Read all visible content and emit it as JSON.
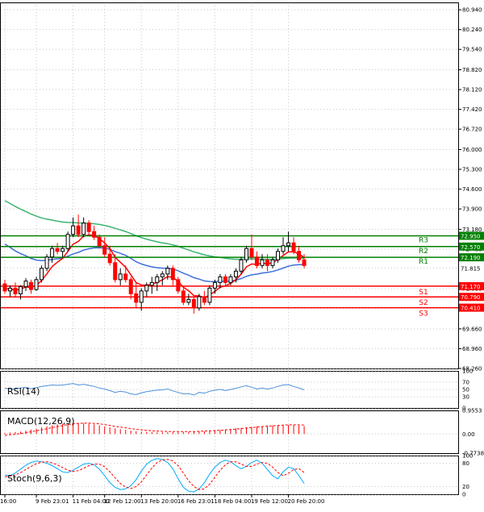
{
  "colors": {
    "background": "#ffffff",
    "grid": "#c8c8c8",
    "frame": "#000000",
    "bull_candle": "#000000",
    "bear_candle": "#ff0000",
    "ema_fast": "#ff0000",
    "ema_medium": "#3f6fd8",
    "ema_slow": "#3cb371",
    "resistance": "#008000",
    "support": "#ff0000",
    "current_price": "#000000",
    "rsi_line": "#4a90d9",
    "macd_signal": "#ff0000",
    "macd_hist": "#ff0000",
    "stoch_main": "#00aaff",
    "stoch_signal": "#ff0000"
  },
  "chart_data": {
    "type": "candlestick",
    "price_panel": {
      "ylim": [
        68.26,
        81.2
      ],
      "y_ticks": [
        "80.940",
        "80.240",
        "79.540",
        "78.820",
        "78.120",
        "77.420",
        "76.720",
        "76.000",
        "75.300",
        "74.600",
        "73.900",
        "73.180",
        "72.480",
        "71.815",
        "71.080",
        "70.380",
        "69.660",
        "68.960",
        "68.260"
      ],
      "y_tick_values": [
        80.94,
        80.24,
        79.54,
        78.82,
        78.12,
        77.42,
        76.72,
        76.0,
        75.3,
        74.6,
        73.9,
        73.18,
        72.48,
        71.815,
        71.08,
        70.38,
        69.66,
        68.96,
        68.26
      ],
      "current_price": {
        "value": 71.815,
        "label": "71.815"
      },
      "levels": [
        {
          "name": "R3",
          "value": 72.95,
          "label": "72.950",
          "kind": "resistance"
        },
        {
          "name": "R2",
          "value": 72.57,
          "label": "72.570",
          "kind": "resistance"
        },
        {
          "name": "R1",
          "value": 72.19,
          "label": "72.190",
          "kind": "resistance"
        },
        {
          "name": "S1",
          "value": 71.17,
          "label": "71.170",
          "kind": "support"
        },
        {
          "name": "S2",
          "value": 70.79,
          "label": "70.790",
          "kind": "support"
        },
        {
          "name": "S3",
          "value": 70.41,
          "label": "70.410",
          "kind": "support"
        }
      ],
      "candles": [
        [
          71.25,
          71.4,
          70.9,
          71.0
        ],
        [
          71.0,
          71.2,
          70.8,
          71.1
        ],
        [
          71.1,
          71.3,
          70.8,
          70.9
        ],
        [
          70.9,
          71.2,
          70.7,
          71.15
        ],
        [
          71.15,
          71.45,
          71.0,
          71.35
        ],
        [
          71.3,
          71.4,
          70.9,
          71.05
        ],
        [
          71.05,
          71.5,
          71.0,
          71.4
        ],
        [
          71.4,
          71.9,
          71.3,
          71.8
        ],
        [
          71.8,
          72.3,
          71.7,
          72.2
        ],
        [
          72.2,
          72.6,
          72.0,
          72.5
        ],
        [
          72.5,
          72.7,
          72.3,
          72.4
        ],
        [
          72.4,
          72.6,
          72.2,
          72.5
        ],
        [
          72.5,
          73.1,
          72.4,
          73.0
        ],
        [
          73.0,
          73.6,
          72.9,
          73.3
        ],
        [
          73.3,
          73.7,
          72.9,
          73.0
        ],
        [
          73.0,
          73.6,
          72.9,
          73.4
        ],
        [
          73.4,
          73.5,
          73.0,
          73.1
        ],
        [
          73.1,
          73.3,
          72.8,
          72.9
        ],
        [
          72.9,
          73.0,
          72.5,
          72.6
        ],
        [
          72.6,
          72.9,
          72.2,
          72.3
        ],
        [
          72.3,
          72.6,
          71.9,
          72.0
        ],
        [
          72.0,
          72.3,
          71.3,
          71.4
        ],
        [
          71.4,
          71.8,
          71.2,
          71.6
        ],
        [
          71.6,
          71.9,
          71.3,
          71.4
        ],
        [
          71.4,
          71.5,
          70.7,
          70.9
        ],
        [
          70.9,
          71.3,
          70.4,
          70.6
        ],
        [
          70.6,
          71.1,
          70.3,
          71.0
        ],
        [
          71.0,
          71.3,
          70.8,
          71.2
        ],
        [
          71.2,
          71.5,
          70.9,
          71.3
        ],
        [
          71.3,
          71.6,
          71.0,
          71.5
        ],
        [
          71.5,
          71.7,
          71.2,
          71.6
        ],
        [
          71.6,
          71.9,
          71.4,
          71.8
        ],
        [
          71.8,
          71.9,
          71.2,
          71.4
        ],
        [
          71.4,
          71.5,
          70.9,
          71.0
        ],
        [
          71.0,
          71.1,
          70.5,
          70.6
        ],
        [
          70.6,
          70.9,
          70.5,
          70.7
        ],
        [
          70.7,
          70.8,
          70.2,
          70.4
        ],
        [
          70.4,
          70.9,
          70.3,
          70.8
        ],
        [
          70.8,
          71.0,
          70.5,
          70.6
        ],
        [
          70.6,
          71.2,
          70.5,
          71.1
        ],
        [
          71.1,
          71.4,
          70.9,
          71.3
        ],
        [
          71.3,
          71.6,
          71.1,
          71.5
        ],
        [
          71.5,
          71.6,
          71.2,
          71.3
        ],
        [
          71.3,
          71.6,
          71.2,
          71.5
        ],
        [
          71.5,
          71.8,
          71.3,
          71.7
        ],
        [
          71.7,
          72.2,
          71.6,
          72.1
        ],
        [
          72.1,
          72.6,
          72.0,
          72.5
        ],
        [
          72.5,
          73.0,
          72.1,
          72.2
        ],
        [
          72.2,
          72.4,
          71.8,
          71.9
        ],
        [
          71.9,
          72.3,
          71.8,
          72.1
        ],
        [
          72.1,
          72.3,
          71.7,
          71.9
        ],
        [
          71.9,
          72.2,
          71.8,
          72.1
        ],
        [
          72.1,
          72.5,
          72.0,
          72.4
        ],
        [
          72.4,
          72.9,
          72.3,
          72.6
        ],
        [
          72.6,
          73.1,
          72.4,
          72.7
        ],
        [
          72.7,
          72.9,
          72.3,
          72.4
        ],
        [
          72.4,
          72.6,
          72.0,
          72.1
        ],
        [
          72.1,
          72.3,
          71.8,
          71.9
        ]
      ]
    },
    "x_axis": {
      "tick_labels": [
        "16:00",
        "9 Feb 23:01",
        "11 Feb 04:00",
        "12 Feb 12:00",
        "13 Feb 20:00",
        "16 Feb 23:01",
        "18 Feb 04:00",
        "19 Feb 12:00",
        "20 Feb 20:00"
      ],
      "tick_indices": [
        0,
        6,
        13,
        19,
        26,
        33,
        40,
        47,
        54
      ]
    },
    "rsi": {
      "label": "RSI(14)",
      "ylim": [
        0,
        100
      ],
      "y_ticks": [
        "100",
        "70",
        "50",
        "30",
        "0"
      ],
      "y_tick_values": [
        100,
        70,
        50,
        30,
        0
      ],
      "values": [
        53,
        52,
        51,
        54,
        56,
        52,
        55,
        58,
        60,
        62,
        61,
        62,
        64,
        66,
        62,
        64,
        61,
        58,
        54,
        51,
        47,
        42,
        45,
        43,
        38,
        36,
        41,
        44,
        46,
        48,
        49,
        51,
        46,
        42,
        38,
        39,
        35,
        42,
        40,
        45,
        48,
        50,
        47,
        50,
        53,
        57,
        60,
        56,
        51,
        54,
        51,
        54,
        58,
        62,
        63,
        58,
        54,
        49
      ]
    },
    "macd": {
      "label": "MACD(12,26,9)",
      "ylim": [
        -0.7738,
        0.9553
      ],
      "y_ticks": [
        "0.9553",
        "0.00",
        "-0.7738"
      ],
      "y_tick_values": [
        0.9553,
        0.0,
        -0.7738
      ],
      "histogram": [
        0.05,
        0.06,
        0.08,
        0.1,
        0.14,
        0.18,
        0.22,
        0.27,
        0.31,
        0.35,
        0.39,
        0.42,
        0.44,
        0.45,
        0.45,
        0.44,
        0.42,
        0.39,
        0.35,
        0.31,
        0.27,
        0.23,
        0.2,
        0.17,
        0.14,
        0.12,
        0.1,
        0.09,
        0.08,
        0.07,
        0.07,
        0.07,
        0.07,
        0.07,
        0.08,
        0.08,
        0.09,
        0.1,
        0.11,
        0.12,
        0.14,
        0.16,
        0.18,
        0.2,
        0.23,
        0.25,
        0.27,
        0.29,
        0.31,
        0.32,
        0.34,
        0.35,
        0.36,
        0.37,
        0.37,
        0.36,
        0.34,
        0.32
      ],
      "signal": [
        -0.05,
        -0.03,
        -0.01,
        0.02,
        0.05,
        0.09,
        0.13,
        0.17,
        0.21,
        0.26,
        0.3,
        0.34,
        0.38,
        0.41,
        0.43,
        0.44,
        0.44,
        0.43,
        0.41,
        0.38,
        0.35,
        0.31,
        0.28,
        0.25,
        0.22,
        0.19,
        0.17,
        0.15,
        0.13,
        0.12,
        0.11,
        0.1,
        0.1,
        0.1,
        0.1,
        0.1,
        0.1,
        0.11,
        0.12,
        0.13,
        0.14,
        0.15,
        0.17,
        0.18,
        0.2,
        0.22,
        0.24,
        0.26,
        0.28,
        0.3,
        0.32,
        0.33,
        0.35,
        0.36,
        0.37,
        0.37,
        0.37,
        0.36
      ]
    },
    "stochastic": {
      "label": "Stoch(9,6,3)",
      "ylim": [
        0,
        100
      ],
      "y_ticks": [
        "100",
        "80",
        "20",
        "0"
      ],
      "y_tick_values": [
        100,
        80,
        20,
        0
      ],
      "main": [
        50,
        48,
        55,
        65,
        75,
        82,
        86,
        84,
        80,
        74,
        66,
        58,
        56,
        62,
        70,
        78,
        80,
        76,
        65,
        48,
        30,
        18,
        12,
        14,
        22,
        38,
        60,
        78,
        88,
        92,
        90,
        82,
        66,
        40,
        18,
        8,
        6,
        14,
        30,
        52,
        70,
        82,
        88,
        84,
        74,
        66,
        72,
        82,
        88,
        80,
        64,
        48,
        40,
        58,
        70,
        66,
        48,
        28
      ],
      "signal": [
        45,
        47,
        50,
        56,
        64,
        72,
        79,
        83,
        84,
        81,
        76,
        69,
        62,
        59,
        61,
        67,
        74,
        78,
        78,
        71,
        58,
        42,
        28,
        19,
        15,
        20,
        32,
        50,
        68,
        82,
        89,
        90,
        86,
        74,
        55,
        35,
        20,
        12,
        14,
        26,
        44,
        62,
        76,
        84,
        84,
        78,
        72,
        72,
        78,
        82,
        80,
        70,
        56,
        48,
        54,
        64,
        66,
        56
      ]
    }
  }
}
